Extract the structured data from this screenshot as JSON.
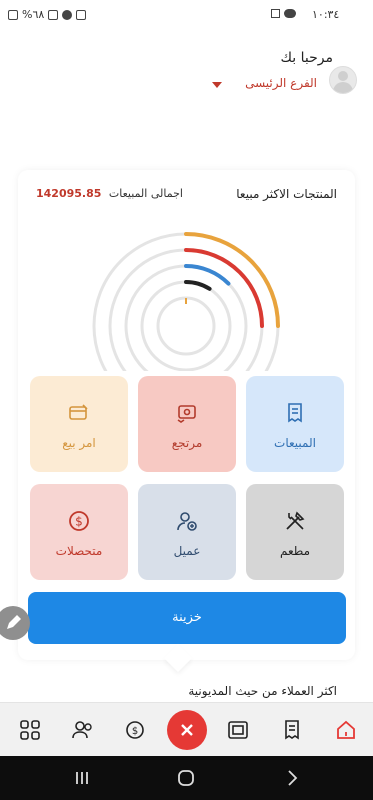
{
  "status_bar": {
    "time": "١٠:٣٤",
    "battery": "%٦٨"
  },
  "header": {
    "greeting": "مرحبا بك",
    "branch": "الفرع الرئيسى"
  },
  "card": {
    "title": "المنتجات الاكثر مبيعا",
    "sales_label": "اجمالى المبيعات",
    "sales_amount": "142095.85"
  },
  "gauge": {
    "ring_progress": [
      0.25,
      0.25,
      0.125,
      0.09,
      0.0
    ],
    "ring_colors": [
      "#e8a33d",
      "#d93a32",
      "#3a86d1",
      "#222222",
      "#e8a33d"
    ],
    "track_color": "#e4e4e4"
  },
  "tiles": {
    "sales": "المبيعات",
    "return": "مرتجع",
    "order": "امر بيع",
    "restaurant": "مطعم",
    "client": "عميل",
    "collections": "متحصلات"
  },
  "treasury_label": "خزينة",
  "debt_title": "اكثر العملاء من حيث المديونية",
  "colors": {
    "accent_blue": "#1e88e5",
    "accent_red": "#c0392b",
    "close_red": "#e53935"
  },
  "nav_icons": [
    "home-icon",
    "receipt-icon",
    "cash-icon",
    "close-icon",
    "payment-icon",
    "users-icon",
    "grid-icon"
  ]
}
